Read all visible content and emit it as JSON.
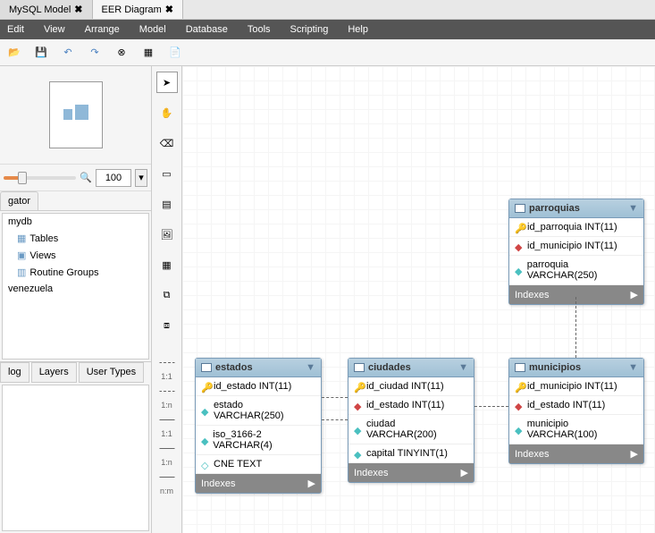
{
  "tabs": [
    {
      "label": "MySQL Model",
      "active": false
    },
    {
      "label": "EER Diagram",
      "active": true
    }
  ],
  "menu": [
    "Edit",
    "View",
    "Arrange",
    "Model",
    "Database",
    "Tools",
    "Scripting",
    "Help"
  ],
  "zoom": {
    "value": "100"
  },
  "nav_tab": "gator",
  "tree": [
    {
      "label": "mydb",
      "indent": 0,
      "icon": ""
    },
    {
      "label": "Tables",
      "indent": 1,
      "icon": "table"
    },
    {
      "label": "Views",
      "indent": 1,
      "icon": "view"
    },
    {
      "label": "Routine Groups",
      "indent": 1,
      "icon": "routine"
    },
    {
      "label": "venezuela",
      "indent": 0,
      "icon": ""
    }
  ],
  "bottom_tabs": [
    "log",
    "Layers",
    "User Types"
  ],
  "tool_labels": {
    "one_one": "1:1",
    "one_n": "1:n",
    "n_m": "n:m"
  },
  "tables": {
    "estados": {
      "title": "estados",
      "cols": [
        {
          "name": "id_estado INT(11)",
          "key": "pk"
        },
        {
          "name": "estado VARCHAR(250)",
          "key": "col"
        },
        {
          "name": "iso_3166-2 VARCHAR(4)",
          "key": "col"
        },
        {
          "name": "CNE TEXT",
          "key": "col"
        }
      ],
      "footer": "Indexes"
    },
    "ciudades": {
      "title": "ciudades",
      "cols": [
        {
          "name": "id_ciudad INT(11)",
          "key": "pk"
        },
        {
          "name": "id_estado INT(11)",
          "key": "fk"
        },
        {
          "name": "ciudad VARCHAR(200)",
          "key": "col"
        },
        {
          "name": "capital TINYINT(1)",
          "key": "col"
        }
      ],
      "footer": "Indexes"
    },
    "municipios": {
      "title": "municipios",
      "cols": [
        {
          "name": "id_municipio INT(11)",
          "key": "pk"
        },
        {
          "name": "id_estado INT(11)",
          "key": "fk"
        },
        {
          "name": "municipio VARCHAR(100)",
          "key": "col"
        }
      ],
      "footer": "Indexes"
    },
    "parroquias": {
      "title": "parroquias",
      "cols": [
        {
          "name": "id_parroquia INT(11)",
          "key": "pk"
        },
        {
          "name": "id_municipio INT(11)",
          "key": "fk"
        },
        {
          "name": "parroquia VARCHAR(250)",
          "key": "col"
        }
      ],
      "footer": "Indexes"
    }
  }
}
